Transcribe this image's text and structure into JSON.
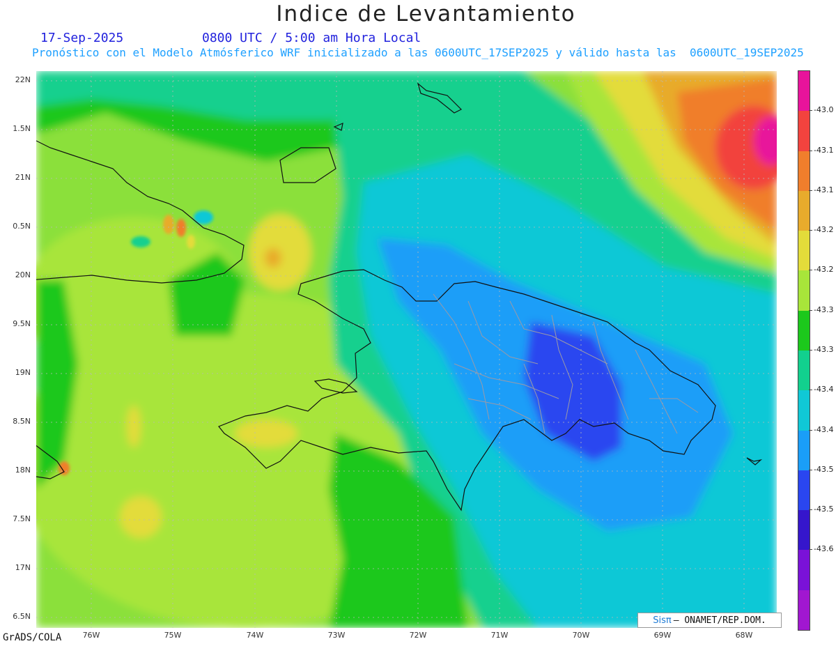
{
  "title": "Indice de Levantamiento",
  "date": "17-Sep-2025",
  "time": "0800 UTC / 5:00 am Hora Local",
  "forecast": "Pronóstico con el Modelo Atmósferico WRF inicializado a las 0600UTC_17SEP2025 y válido hasta las  0600UTC_19SEP2025",
  "credit": "GrADS/COLA",
  "logo": {
    "brand": "Sisπ",
    "text": "– ONAMET/REP.DOM."
  },
  "map": {
    "lat_labels": [
      "22N",
      "1.5N",
      "21N",
      "0.5N",
      "20N",
      "9.5N",
      "19N",
      "8.5N",
      "18N",
      "7.5N",
      "17N",
      "6.5N"
    ],
    "lon_labels": [
      "76W",
      "75W",
      "74W",
      "73W",
      "72W",
      "71W",
      "70W",
      "69W",
      "68W"
    ],
    "background_color": "#8be03a"
  },
  "colorbar": {
    "colors": [
      "#e8139b",
      "#f2433e",
      "#f07e2c",
      "#e8ab2c",
      "#e3dc3a",
      "#a8e53a",
      "#1cc81c",
      "#12d08e",
      "#10c8d6",
      "#1a9ef8",
      "#2a46f0",
      "#3516cc",
      "#7a12d8",
      "#a117d0"
    ],
    "labels": [
      "-43.0",
      "-43.1",
      "-43.1",
      "-43.2",
      "-43.2",
      "-43.3",
      "-43.3",
      "-43.4",
      "-43.4",
      "-43.5",
      "-43.5",
      "-43.6"
    ]
  }
}
